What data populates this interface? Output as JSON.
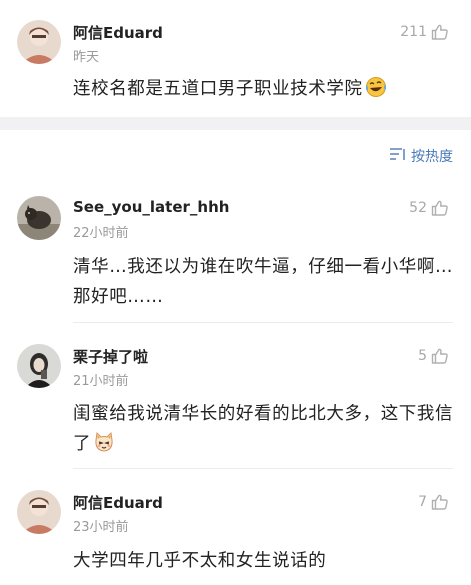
{
  "sort": {
    "label": "按热度",
    "icon": "sort-lines-icon"
  },
  "colors": {
    "accent": "#4a7ab7",
    "muted": "#9a9a9a",
    "text": "#222222",
    "section_gap": "#f1f1f3"
  },
  "top_comment": {
    "username": "阿信Eduard",
    "time": "昨天",
    "likes": "211",
    "text": "连校名都是五道口男子职业技术学院",
    "emoji": "laughing-crying-emoji"
  },
  "replies": [
    {
      "username": "See_you_later_hhh",
      "time": "22小时前",
      "likes": "52",
      "text": "清华…我还以为谁在吹牛逼，仔细一看小华啊…那好吧……"
    },
    {
      "username": "栗子掉了啦",
      "time": "21小时前",
      "likes": "5",
      "text": "闺蜜给我说清华长的好看的比北大多，这下我信了",
      "emoji": "cat-face-emoji"
    },
    {
      "username": "阿信Eduard",
      "time": "23小时前",
      "likes": "7",
      "text": "大学四年几乎不太和女生说话的"
    }
  ]
}
